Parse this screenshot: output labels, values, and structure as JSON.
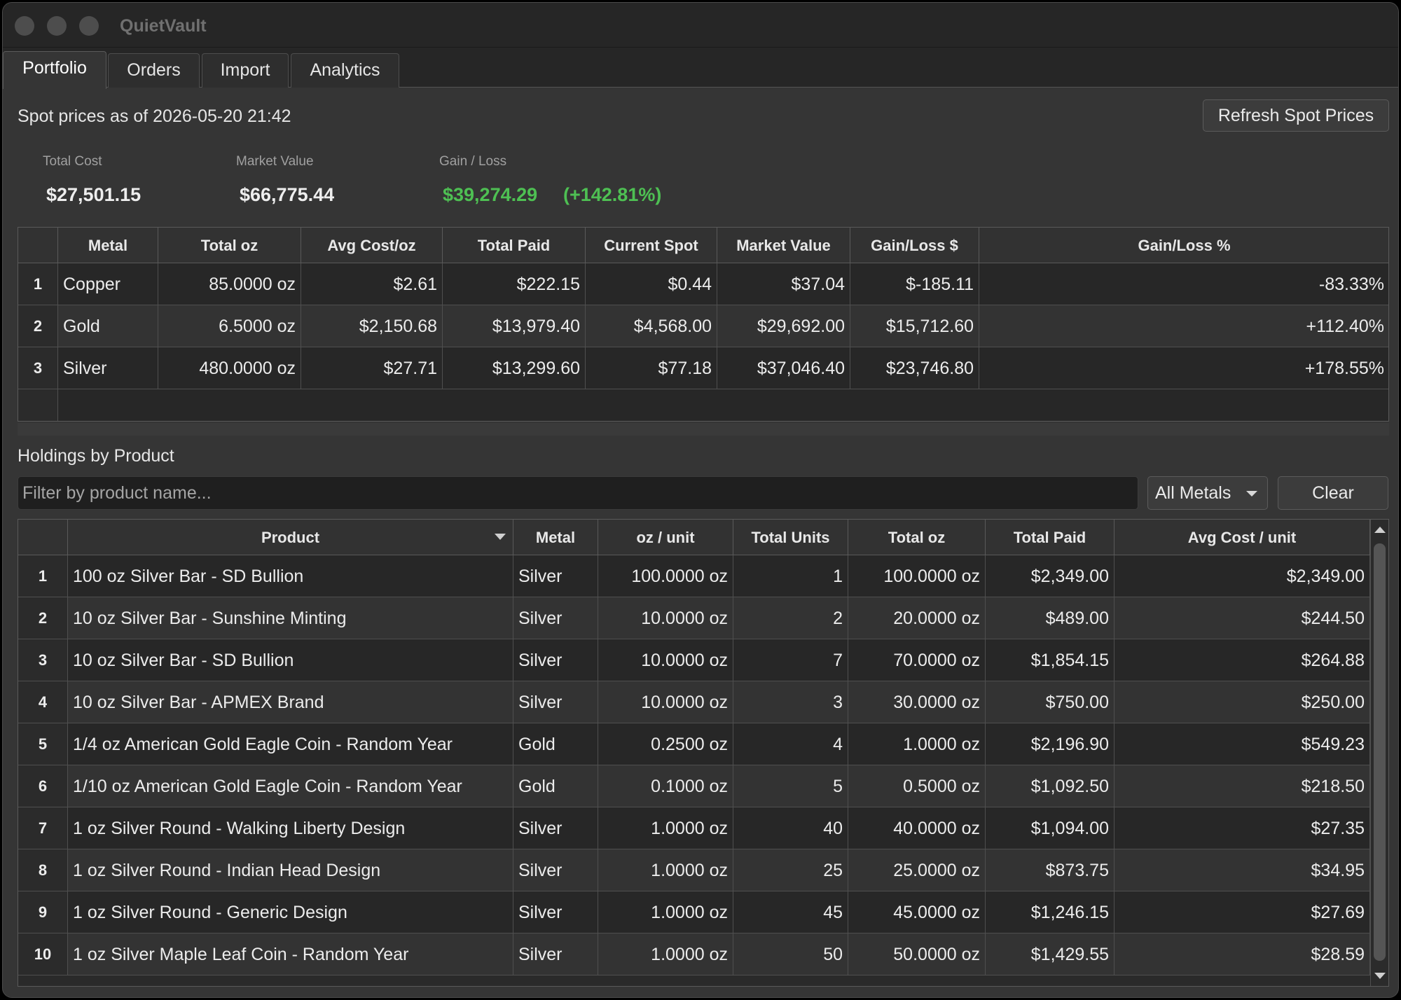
{
  "window": {
    "title": "QuietVault"
  },
  "tabs": [
    "Portfolio",
    "Orders",
    "Import",
    "Analytics"
  ],
  "spot": {
    "label": "Spot prices as of 2026-05-20 21:42",
    "refresh_label": "Refresh Spot Prices"
  },
  "summary": {
    "total_cost_label": "Total Cost",
    "total_cost": "$27,501.15",
    "market_value_label": "Market Value",
    "market_value": "$66,775.44",
    "gain_loss_label": "Gain / Loss",
    "gain_loss": "$39,274.29",
    "gain_loss_pct": "(+142.81%)"
  },
  "colors": {
    "gain": "#4ec053",
    "loss": "#ee4a44",
    "background": "#353535"
  },
  "metals_table": {
    "columns": [
      "Metal",
      "Total oz",
      "Avg Cost/oz",
      "Total Paid",
      "Current Spot",
      "Market Value",
      "Gain/Loss $",
      "Gain/Loss %"
    ],
    "rows": [
      {
        "n": "1",
        "metal": "Copper",
        "total_oz": "85.0000 oz",
        "avg_cost": "$2.61",
        "total_paid": "$222.15",
        "spot": "$0.44",
        "market_value": "$37.04",
        "gl": "$-185.11",
        "gl_pct": "-83.33%",
        "status": "loss"
      },
      {
        "n": "2",
        "metal": "Gold",
        "total_oz": "6.5000 oz",
        "avg_cost": "$2,150.68",
        "total_paid": "$13,979.40",
        "spot": "$4,568.00",
        "market_value": "$29,692.00",
        "gl": "$15,712.60",
        "gl_pct": "+112.40%",
        "status": "gain"
      },
      {
        "n": "3",
        "metal": "Silver",
        "total_oz": "480.0000 oz",
        "avg_cost": "$27.71",
        "total_paid": "$13,299.60",
        "spot": "$77.18",
        "market_value": "$37,046.40",
        "gl": "$23,746.80",
        "gl_pct": "+178.55%",
        "status": "gain"
      }
    ]
  },
  "holdings": {
    "label": "Holdings by Product",
    "filter_placeholder": "Filter by product name...",
    "metal_filter": "All Metals",
    "clear_label": "Clear",
    "columns": [
      "Product",
      "Metal",
      "oz / unit",
      "Total Units",
      "Total oz",
      "Total Paid",
      "Avg Cost / unit"
    ],
    "rows": [
      {
        "n": "1",
        "product": "100 oz Silver Bar - SD Bullion",
        "metal": "Silver",
        "oz_unit": "100.0000 oz",
        "units": "1",
        "total_oz": "100.0000 oz",
        "paid": "$2,349.00",
        "avg": "$2,349.00"
      },
      {
        "n": "2",
        "product": "10 oz Silver Bar - Sunshine Minting",
        "metal": "Silver",
        "oz_unit": "10.0000 oz",
        "units": "2",
        "total_oz": "20.0000 oz",
        "paid": "$489.00",
        "avg": "$244.50"
      },
      {
        "n": "3",
        "product": "10 oz Silver Bar - SD Bullion",
        "metal": "Silver",
        "oz_unit": "10.0000 oz",
        "units": "7",
        "total_oz": "70.0000 oz",
        "paid": "$1,854.15",
        "avg": "$264.88"
      },
      {
        "n": "4",
        "product": "10 oz Silver Bar - APMEX Brand",
        "metal": "Silver",
        "oz_unit": "10.0000 oz",
        "units": "3",
        "total_oz": "30.0000 oz",
        "paid": "$750.00",
        "avg": "$250.00"
      },
      {
        "n": "5",
        "product": "1/4 oz American Gold Eagle Coin - Random Year",
        "metal": "Gold",
        "oz_unit": "0.2500 oz",
        "units": "4",
        "total_oz": "1.0000 oz",
        "paid": "$2,196.90",
        "avg": "$549.23"
      },
      {
        "n": "6",
        "product": "1/10 oz American Gold Eagle Coin - Random Year",
        "metal": "Gold",
        "oz_unit": "0.1000 oz",
        "units": "5",
        "total_oz": "0.5000 oz",
        "paid": "$1,092.50",
        "avg": "$218.50"
      },
      {
        "n": "7",
        "product": "1 oz Silver Round - Walking Liberty Design",
        "metal": "Silver",
        "oz_unit": "1.0000 oz",
        "units": "40",
        "total_oz": "40.0000 oz",
        "paid": "$1,094.00",
        "avg": "$27.35"
      },
      {
        "n": "8",
        "product": "1 oz Silver Round - Indian Head Design",
        "metal": "Silver",
        "oz_unit": "1.0000 oz",
        "units": "25",
        "total_oz": "25.0000 oz",
        "paid": "$873.75",
        "avg": "$34.95"
      },
      {
        "n": "9",
        "product": "1 oz Silver Round - Generic Design",
        "metal": "Silver",
        "oz_unit": "1.0000 oz",
        "units": "45",
        "total_oz": "45.0000 oz",
        "paid": "$1,246.15",
        "avg": "$27.69"
      },
      {
        "n": "10",
        "product": "1 oz Silver Maple Leaf Coin - Random Year",
        "metal": "Silver",
        "oz_unit": "1.0000 oz",
        "units": "50",
        "total_oz": "50.0000 oz",
        "paid": "$1,429.55",
        "avg": "$28.59"
      }
    ]
  }
}
